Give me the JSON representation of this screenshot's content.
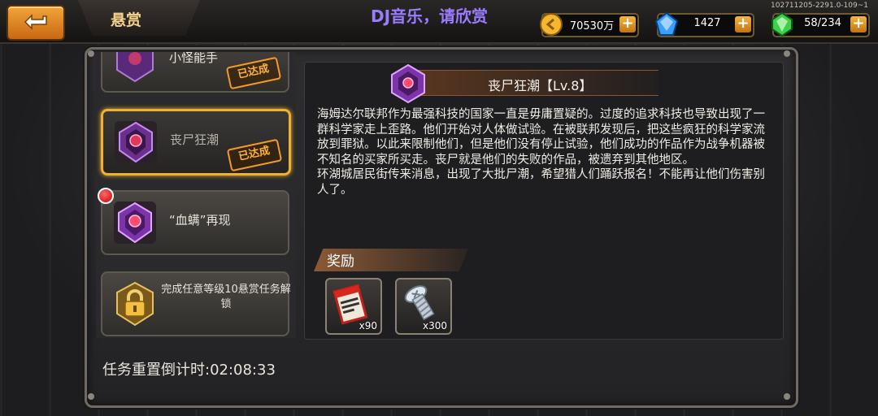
{
  "header": {
    "title": "悬赏",
    "overlay_text": "DJ音乐，请欣赏",
    "version": "102711205-2291.0-109~1"
  },
  "resources": [
    {
      "name": "gold",
      "value": "70530万",
      "icon": "gold-coin-icon",
      "color": "#f5b630"
    },
    {
      "name": "diamond",
      "value": "1427",
      "icon": "blue-gem-icon",
      "color": "#3aa0ff"
    },
    {
      "name": "energy",
      "value": "58/234",
      "icon": "green-crystal-icon",
      "color": "#3ed04a"
    }
  ],
  "tasks": [
    {
      "label": "小怪能手",
      "status": "已达成"
    },
    {
      "label": "丧尸狂潮",
      "status": "已达成",
      "selected": true
    },
    {
      "label": "“血螨”再现",
      "status": ""
    },
    {
      "label": "完成任意等级10悬赏任务解锁",
      "status": "locked"
    }
  ],
  "detail": {
    "title": "丧尸狂潮【Lv.8】",
    "description": [
      "海姆达尔联邦作为最强科技的国家一直是毋庸置疑的。过度的追求科技也导致出现了一群科学家走上歪路。他们开始对人体做试验。在被联邦发现后，把这些疯狂的科学家流放到罪狱。以此来限制他们，但是他们没有停止试验，他们成功的作品作为战争机器被不知名的买家所买走。丧尸就是他们的失败的作品，被遗弃到其他地区。",
      "环湖城居民街传来消息，出现了大批尸潮，希望猎人们踊跃报名！不能再让他们伤害别人了。"
    ],
    "reward_label": "奖励",
    "rewards": [
      {
        "icon": "ticket-scroll-icon",
        "count": "x90"
      },
      {
        "icon": "screw-bolt-icon",
        "count": "x300"
      }
    ]
  },
  "footer": {
    "countdown": "任务重置倒计时:02:08:33"
  }
}
